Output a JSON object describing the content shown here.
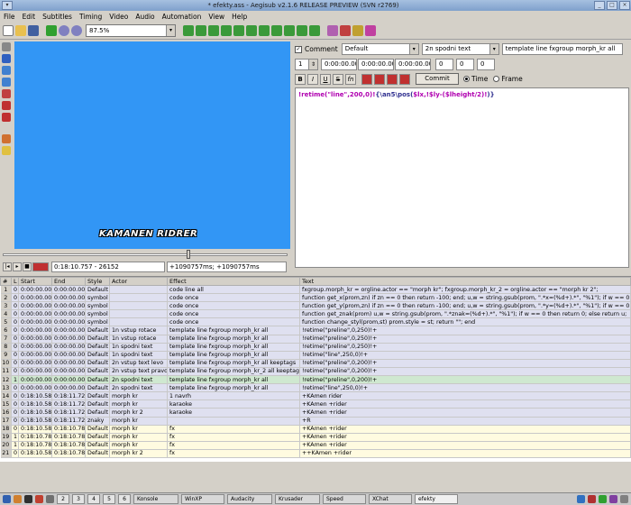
{
  "window": {
    "title": "* efekty.ass - Aegisub v2.1.6 RELEASE PREVIEW (SVN r2769)",
    "btn_min": "_",
    "btn_max": "□",
    "btn_close": "×"
  },
  "menu": [
    "File",
    "Edit",
    "Subtitles",
    "Timing",
    "Video",
    "Audio",
    "Automation",
    "View",
    "Help"
  ],
  "toolbar": {
    "zoom": "87.5%",
    "arrow": "▾"
  },
  "video": {
    "subtitle_preview": "KAMANEN RIDRER"
  },
  "playback": {
    "btn_prev": "|◂",
    "btn_play": "▸",
    "btn_stop": "■",
    "time_frame": "0:18:10.757 - 26152",
    "offset": "+1090757ms; +1090757ms"
  },
  "editor": {
    "comment_label": "Comment",
    "comment_check": "✓",
    "style": "Default",
    "actor": "2n spodni text",
    "effect": "template line fxgroup morph_kr all",
    "layer": "1",
    "start": "0:00:00.00",
    "end": "0:00:00.00",
    "duration": "0:00:00.00",
    "margin_l": "0",
    "margin_r": "0",
    "margin_v": "0",
    "commit_label": "Commit",
    "time_label": "Time",
    "frame_label": "Frame",
    "fmt_bold": "B",
    "fmt_italic": "I",
    "fmt_underline": "U",
    "fmt_strike": "S",
    "fmt_font": "fn",
    "text_prefix": "!retime(\"line\",200,0)!",
    "text_middle": "{\\an5\\pos(",
    "text_var": "$lx,!$ly-($lheight/2)!",
    "text_suffix": ")}"
  },
  "grid": {
    "headers": [
      "#",
      "L",
      "Start",
      "End",
      "Style",
      "Actor",
      "Effect",
      "Text"
    ],
    "rows": [
      {
        "n": "1",
        "l": "0",
        "start": "0:00:00.00",
        "end": "0:00:00.00",
        "style": "Default",
        "actor": "",
        "effect": "code line all",
        "text": "fxgroup.morph_kr = orgline.actor == \"morph kr\"; fxgroup.morph_kr_2 = orgline.actor == \"morph kr 2\";",
        "kind": "comment"
      },
      {
        "n": "2",
        "l": "0",
        "start": "0:00:00.00",
        "end": "0:00:00.00",
        "style": "symbol",
        "actor": "",
        "effect": "code once",
        "text": "function get_x(prom,zn) if zn == 0 then return -100; end; u,w = string.gsub(prom, \".*x=(%d+).*\", \"%1\"); if w == 0",
        "kind": "comment"
      },
      {
        "n": "3",
        "l": "0",
        "start": "0:00:00.00",
        "end": "0:00:00.00",
        "style": "symbol",
        "actor": "",
        "effect": "code once",
        "text": "function get_y(prom,zn) if zn == 0 then return -100; end; u,w = string.gsub(prom, \".*y=(%d+).*\", \"%1\"); if w == 0",
        "kind": "comment"
      },
      {
        "n": "4",
        "l": "0",
        "start": "0:00:00.00",
        "end": "0:00:00.00",
        "style": "symbol",
        "actor": "",
        "effect": "code once",
        "text": "function get_znak(prom) u,w = string.gsub(prom, \".*znak=(%d+).*\", \"%1\"); if w == 0 then return 0; else return u;",
        "kind": "comment"
      },
      {
        "n": "5",
        "l": "0",
        "start": "0:00:00.00",
        "end": "0:00:00.00",
        "style": "symbol",
        "actor": "",
        "effect": "code once",
        "text": "function change_styl(prom,st) prom.style = st; return \"\";  end",
        "kind": "comment"
      },
      {
        "n": "6",
        "l": "0",
        "start": "0:00:00.00",
        "end": "0:00:00.00",
        "style": "Default",
        "actor": "1n vstup rotace",
        "effect": "template line fxgroup morph_kr all",
        "text": "!retime(\"preline\",0,250)!+",
        "kind": "comment"
      },
      {
        "n": "7",
        "l": "0",
        "start": "0:00:00.00",
        "end": "0:00:00.00",
        "style": "Default",
        "actor": "1n vstup rotace",
        "effect": "template line fxgroup morph_kr all",
        "text": "!retime(\"preline\",0,250)!+",
        "kind": "comment"
      },
      {
        "n": "8",
        "l": "0",
        "start": "0:00:00.00",
        "end": "0:00:00.00",
        "style": "Default",
        "actor": "1n spodni text",
        "effect": "template line fxgroup morph_kr all",
        "text": "!retime(\"preline\",0,250)!+",
        "kind": "comment"
      },
      {
        "n": "9",
        "l": "0",
        "start": "0:00:00.00",
        "end": "0:00:00.00",
        "style": "Default",
        "actor": "1n spodni text",
        "effect": "template line fxgroup morph_kr all",
        "text": "!retime(\"line\",250,0)!+",
        "kind": "comment"
      },
      {
        "n": "10",
        "l": "0",
        "start": "0:00:00.00",
        "end": "0:00:00.00",
        "style": "Default",
        "actor": "2n vstup text levo",
        "effect": "template line fxgroup morph_kr all keeptags",
        "text": "!retime(\"preline\",0,200)!+",
        "kind": "comment"
      },
      {
        "n": "11",
        "l": "0",
        "start": "0:00:00.00",
        "end": "0:00:00.00",
        "style": "Default",
        "actor": "2n vstup text pravo",
        "effect": "template line fxgroup morph_kr_2 all keeptags",
        "text": "!retime(\"preline\",0,200)!+",
        "kind": "comment"
      },
      {
        "n": "12",
        "l": "1",
        "start": "0:00:00.00",
        "end": "0:00:00.00",
        "style": "Default",
        "actor": "2n spodni text",
        "effect": "template line fxgroup morph_kr all",
        "text": "!retime(\"preline\",0,200)!+",
        "kind": "sel"
      },
      {
        "n": "13",
        "l": "0",
        "start": "0:00:00.00",
        "end": "0:00:00.00",
        "style": "Default",
        "actor": "2n spodni text",
        "effect": "template line fxgroup morph_kr all",
        "text": "!retime(\"line\",250,0)!+",
        "kind": "comment"
      },
      {
        "n": "14",
        "l": "0",
        "start": "0:18:10.58",
        "end": "0:18:11.72",
        "style": "Default",
        "actor": "morph kr",
        "effect": "1 navrh",
        "text": "+KAmen rider",
        "kind": "comment"
      },
      {
        "n": "15",
        "l": "0",
        "start": "0:18:10.58",
        "end": "0:18:11.72",
        "style": "Default",
        "actor": "morph kr",
        "effect": "karaoke",
        "text": "+KAmen +rider",
        "kind": "comment"
      },
      {
        "n": "16",
        "l": "0",
        "start": "0:18:10.58",
        "end": "0:18:11.72",
        "style": "Default",
        "actor": "morph kr 2",
        "effect": "karaoke",
        "text": "+KAmen +rider",
        "kind": "comment"
      },
      {
        "n": "17",
        "l": "0",
        "start": "0:18:10.58",
        "end": "0:18:11.72",
        "style": "znaky",
        "actor": "morph kr",
        "effect": "",
        "text": "+R",
        "kind": "comment"
      },
      {
        "n": "18",
        "l": "0",
        "start": "0:18:10.58",
        "end": "0:18:10.78",
        "style": "Default",
        "actor": "morph kr",
        "effect": "fx",
        "text": "+KAmen +rider",
        "kind": "fx"
      },
      {
        "n": "19",
        "l": "1",
        "start": "0:18:10.78",
        "end": "0:18:10.78",
        "style": "Default",
        "actor": "morph kr",
        "effect": "fx",
        "text": "+KAmen +rider",
        "kind": "fx"
      },
      {
        "n": "20",
        "l": "1",
        "start": "0:18:10.78",
        "end": "0:18:10.78",
        "style": "Default",
        "actor": "morph kr",
        "effect": "fx",
        "text": "+KAmen +rider",
        "kind": "fx"
      },
      {
        "n": "21",
        "l": "0",
        "start": "0:18:10.58",
        "end": "0:18:10.78",
        "style": "Default",
        "actor": "morph kr 2",
        "effect": "fx",
        "text": "++KAmen +rider",
        "kind": "fx"
      }
    ]
  },
  "taskbar": {
    "desktops": [
      "2",
      "3",
      "4",
      "5",
      "6"
    ],
    "tasks": [
      "Konsole",
      "WinXP",
      "Audacity",
      "Krusader",
      "Speed",
      "XChat",
      "efekty"
    ]
  }
}
